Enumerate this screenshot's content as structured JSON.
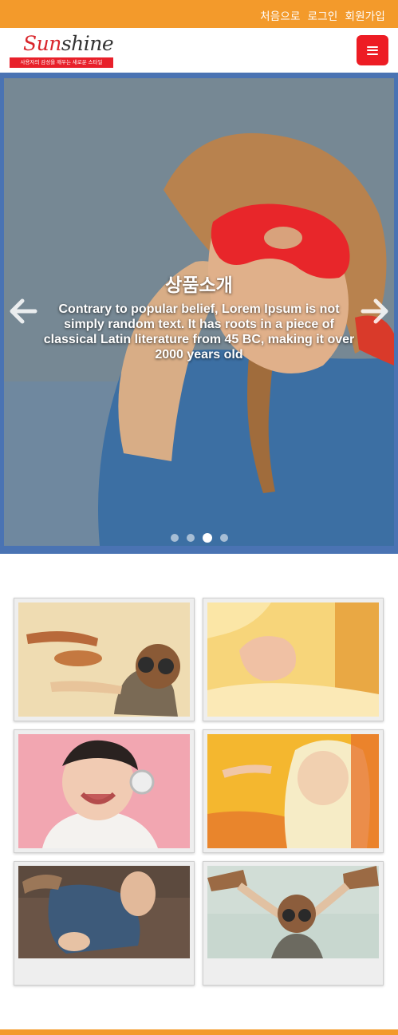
{
  "topbar": {
    "links": [
      "처음으로",
      "로그인",
      "회원가입"
    ]
  },
  "header": {
    "logo_first": "Sun",
    "logo_rest": "shine",
    "tagline": "사용자의 감성을 깨우는 새로운 스타일",
    "menu_icon": "hamburger-icon"
  },
  "hero": {
    "title": "상품소개",
    "description": "Contrary to popular belief, Lorem Ipsum is not simply random text. It has roots in a piece of classical Latin literature from 45 BC, making it over 2000 years old",
    "slide_count": 4,
    "active_slide": 3,
    "prev_icon": "chevron-left-icon",
    "next_icon": "chevron-right-icon"
  },
  "colors": {
    "topbar": "#f39a2b",
    "menu_button": "#ed1c24",
    "logo_red": "#d9262c",
    "hero_frame": "#4a73b3"
  }
}
